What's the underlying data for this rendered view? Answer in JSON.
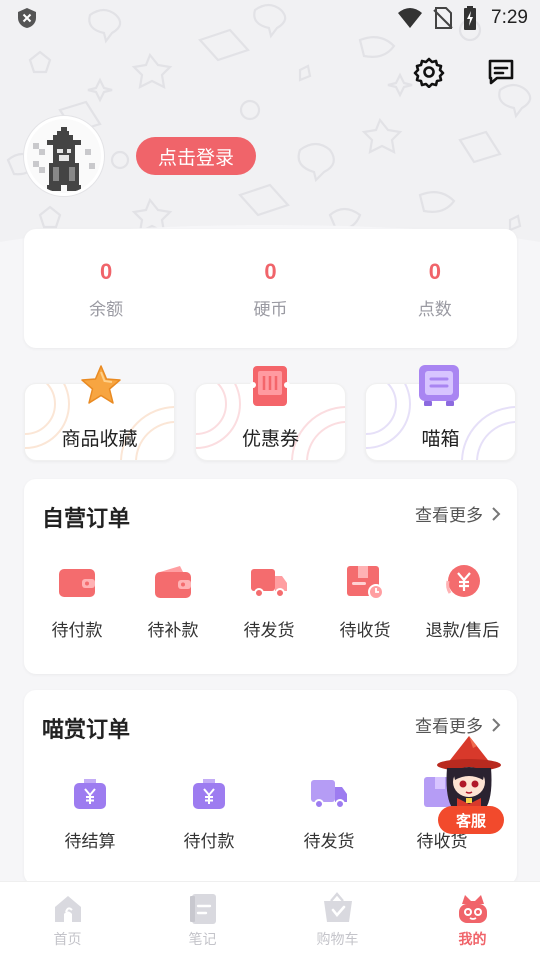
{
  "status_bar": {
    "time": "7:29",
    "icons": [
      "shield-icon",
      "wifi-icon",
      "no-sim-icon",
      "battery-charging-icon"
    ]
  },
  "header": {
    "icons": [
      "settings-gear-icon",
      "message-icon"
    ],
    "login_label": "点击登录"
  },
  "stats": [
    {
      "value": "0",
      "label": "余额"
    },
    {
      "value": "0",
      "label": "硬币"
    },
    {
      "value": "0",
      "label": "点数"
    }
  ],
  "quick_links": [
    {
      "label": "商品收藏",
      "icon": "star-icon"
    },
    {
      "label": "优惠券",
      "icon": "ticket-icon"
    },
    {
      "label": "喵箱",
      "icon": "box-icon"
    }
  ],
  "self_orders": {
    "title": "自营订单",
    "more": "查看更多",
    "items": [
      {
        "label": "待付款",
        "icon": "wallet-icon"
      },
      {
        "label": "待补款",
        "icon": "wallet-open-icon"
      },
      {
        "label": "待发货",
        "icon": "truck-icon"
      },
      {
        "label": "待收货",
        "icon": "package-icon"
      },
      {
        "label": "退款/售后",
        "icon": "refund-yen-icon"
      }
    ]
  },
  "reward_orders": {
    "title": "喵赏订单",
    "more": "查看更多",
    "items": [
      {
        "label": "待结算",
        "icon": "bag-yen-icon"
      },
      {
        "label": "待付款",
        "icon": "bag-yen-icon"
      },
      {
        "label": "待发货",
        "icon": "truck-icon"
      },
      {
        "label": "待收货",
        "icon": "package-icon"
      }
    ]
  },
  "customer_service": {
    "label": "客服"
  },
  "tabbar": [
    {
      "label": "首页",
      "icon": "home-icon",
      "active": false
    },
    {
      "label": "笔记",
      "icon": "note-icon",
      "active": false
    },
    {
      "label": "购物车",
      "icon": "cart-icon",
      "active": false
    },
    {
      "label": "我的",
      "icon": "me-icon",
      "active": true
    }
  ],
  "colors": {
    "accent": "#f0646a",
    "order_red": "#f46c6e",
    "reward_purple": "#9d7cf0",
    "kefu_red": "#f24a2c"
  }
}
